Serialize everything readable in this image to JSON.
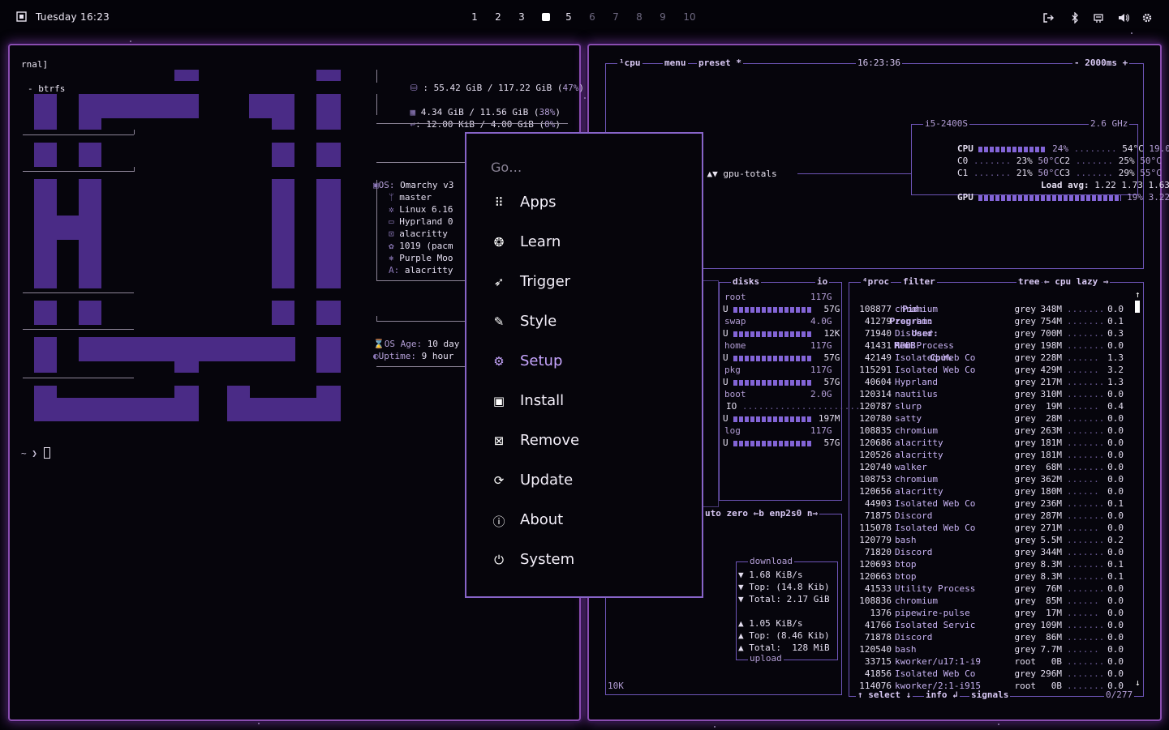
{
  "topbar": {
    "clock": "Tuesday 16:23",
    "workspaces": [
      "1",
      "2",
      "3",
      "4",
      "5",
      "6",
      "7",
      "8",
      "9",
      "10"
    ],
    "active_workspace": "4",
    "tray_icons": [
      "logout-icon",
      "bluetooth-icon",
      "network-icon",
      "volume-icon",
      "settings-icon"
    ]
  },
  "terminal": {
    "fastfetch_top": "rnal]",
    "fastfetch_fs": "- btrfs",
    "disk": ": 55.42 GiB / 117.22 GiB (",
    "disk_pct": "47%",
    "disk_close": ")",
    "mem": "4.34 GiB / 11.56 GiB (",
    "mem_pct": "38%",
    "mem_close": ")",
    "swap": ": 12.00 KiB / 4.00 GiB (",
    "swap_pct": "0%",
    "swap_close": ")",
    "info": [
      {
        "key": "OS:",
        "val": "Omarchy v3"
      },
      {
        "key": "",
        "val": "master"
      },
      {
        "key": "",
        "val": "Linux 6.16"
      },
      {
        "key": "",
        "val": "Hyprland 0"
      },
      {
        "key": "",
        "val": "alacritty"
      },
      {
        "key": "",
        "val": "1019 (pacm"
      },
      {
        "key": "",
        "val": "Purple Moo"
      },
      {
        "key": "A:",
        "val": "alacritty"
      }
    ],
    "age_label": "OS Age:",
    "age_val": "10 day",
    "uptime_label": "Uptime:",
    "uptime_val": "9 hour",
    "prompt": "~ ❯"
  },
  "menu": {
    "placeholder": "Go…",
    "items": [
      {
        "label": "Apps",
        "icon": "apps-grid-icon",
        "glyph": "⠿"
      },
      {
        "label": "Learn",
        "icon": "brain-icon",
        "glyph": "❂"
      },
      {
        "label": "Trigger",
        "icon": "rocket-icon",
        "glyph": "➶"
      },
      {
        "label": "Style",
        "icon": "magic-wand-icon",
        "glyph": "✎"
      },
      {
        "label": "Setup",
        "icon": "gear-icon",
        "glyph": "⚙"
      },
      {
        "label": "Install",
        "icon": "floppy-icon",
        "glyph": "▣"
      },
      {
        "label": "Remove",
        "icon": "remove-box-icon",
        "glyph": "⊠"
      },
      {
        "label": "Update",
        "icon": "refresh-icon",
        "glyph": "⟳"
      },
      {
        "label": "About",
        "icon": "info-icon",
        "glyph": "ⓘ"
      },
      {
        "label": "System",
        "icon": "power-icon",
        "glyph": "⏻"
      }
    ],
    "selected": "Setup"
  },
  "btop": {
    "header": {
      "cpu": "¹cpu",
      "menu": "menu",
      "preset": "preset *",
      "time": "16:23:36",
      "interval": "- 2000ms +"
    },
    "cpu": {
      "model": "i5-2400S",
      "freq": "2.6 GHz",
      "total_label": "CPU",
      "total_pct": "24%",
      "total_temp": "54°C",
      "total_power": "19.0W",
      "cores": [
        {
          "n": "C0",
          "pct": "23%",
          "temp": "50°C"
        },
        {
          "n": "C2",
          "pct": "25%",
          "temp": "50°C"
        },
        {
          "n": "C1",
          "pct": "21%",
          "temp": "50°C"
        },
        {
          "n": "C3",
          "pct": "29%",
          "temp": "55°C"
        }
      ],
      "load_label": "Load avg:",
      "load": "1.22 1.73 1.63",
      "gpu_label": "GPU",
      "gpu_pct": "19%",
      "gpu_power": "3.22W",
      "gpu_totals": "tal ▲▼ gpu-totals"
    },
    "disks": {
      "title": "disks",
      "io": "io",
      "items": [
        {
          "name": "root",
          "size": "117G",
          "used": "57G"
        },
        {
          "name": "swap",
          "size": "4.0G",
          "used": "12K"
        },
        {
          "name": "home",
          "size": "117G",
          "used": "57G"
        },
        {
          "name": "pkg",
          "size": "117G",
          "used": "57G"
        },
        {
          "name": "boot",
          "size": "2.0G",
          "used": "197M"
        },
        {
          "name": "log",
          "size": "117G",
          "used": "57G"
        }
      ],
      "io_label": "IO"
    },
    "net": {
      "header": "uto zero ⇐b enp2s0 n⇒",
      "download_title": "download",
      "dl_rate": "1.68 KiB/s",
      "dl_top": "Top: (14.8 Kib)",
      "dl_total": "Total: 2.17 GiB",
      "ul_rate": "1.05 KiB/s",
      "ul_top": "Top: (8.46 Kib)",
      "ul_total": "Total:  128 MiB",
      "upload_title": "upload",
      "scale": "10K"
    },
    "proc": {
      "title": "⁴proc",
      "filter": "filter",
      "tree": "tree",
      "cpu_lazy": "⇐ cpu lazy ⇒",
      "columns": [
        "Pid:",
        "Program:",
        "User:",
        "MemB",
        "Cpu%"
      ],
      "rows": [
        [
          "108877",
          "chromium",
          "grey",
          "348M",
          "0.0"
        ],
        [
          "41279",
          "zen-bin",
          "grey",
          "754M",
          "0.1"
        ],
        [
          "71940",
          "Discord",
          "grey",
          "700M",
          "0.3"
        ],
        [
          "41431",
          "RDD Process",
          "grey",
          "198M",
          "0.0"
        ],
        [
          "42149",
          "Isolated Web Co",
          "grey",
          "228M",
          "1.3"
        ],
        [
          "115291",
          "Isolated Web Co",
          "grey",
          "429M",
          "3.2"
        ],
        [
          "40604",
          "Hyprland",
          "grey",
          "217M",
          "1.3"
        ],
        [
          "120314",
          "nautilus",
          "grey",
          "310M",
          "0.0"
        ],
        [
          "120787",
          "slurp",
          "grey",
          "19M",
          "0.4"
        ],
        [
          "120780",
          "satty",
          "grey",
          "28M",
          "0.0"
        ],
        [
          "108835",
          "chromium",
          "grey",
          "263M",
          "0.0"
        ],
        [
          "120686",
          "alacritty",
          "grey",
          "181M",
          "0.0"
        ],
        [
          "120526",
          "alacritty",
          "grey",
          "181M",
          "0.0"
        ],
        [
          "120740",
          "walker",
          "grey",
          "68M",
          "0.0"
        ],
        [
          "108753",
          "chromium",
          "grey",
          "362M",
          "0.0"
        ],
        [
          "120656",
          "alacritty",
          "grey",
          "180M",
          "0.0"
        ],
        [
          "44903",
          "Isolated Web Co",
          "grey",
          "236M",
          "0.1"
        ],
        [
          "71875",
          "Discord",
          "grey",
          "287M",
          "0.0"
        ],
        [
          "115078",
          "Isolated Web Co",
          "grey",
          "271M",
          "0.0"
        ],
        [
          "120779",
          "bash",
          "grey",
          "5.5M",
          "0.2"
        ],
        [
          "71820",
          "Discord",
          "grey",
          "344M",
          "0.0"
        ],
        [
          "120693",
          "btop",
          "grey",
          "8.3M",
          "0.1"
        ],
        [
          "120663",
          "btop",
          "grey",
          "8.3M",
          "0.1"
        ],
        [
          "41533",
          "Utility Process",
          "grey",
          "76M",
          "0.0"
        ],
        [
          "108836",
          "chromium",
          "grey",
          "85M",
          "0.0"
        ],
        [
          "1376",
          "pipewire-pulse",
          "grey",
          "17M",
          "0.0"
        ],
        [
          "41766",
          "Isolated Servic",
          "grey",
          "109M",
          "0.0"
        ],
        [
          "71878",
          "Discord",
          "grey",
          "86M",
          "0.0"
        ],
        [
          "120540",
          "bash",
          "grey",
          "7.7M",
          "0.0"
        ],
        [
          "33715",
          "kworker/u17:1-i9",
          "root",
          "0B",
          "0.0"
        ],
        [
          "41856",
          "Isolated Web Co",
          "grey",
          "296M",
          "0.0"
        ],
        [
          "114076",
          "kworker/2:1-i915",
          "root",
          "0B",
          "0.0"
        ]
      ],
      "footer_select": "↑ select ↓",
      "footer_info": "info ↲",
      "footer_signals": "signals",
      "footer_count": "0/277"
    }
  }
}
